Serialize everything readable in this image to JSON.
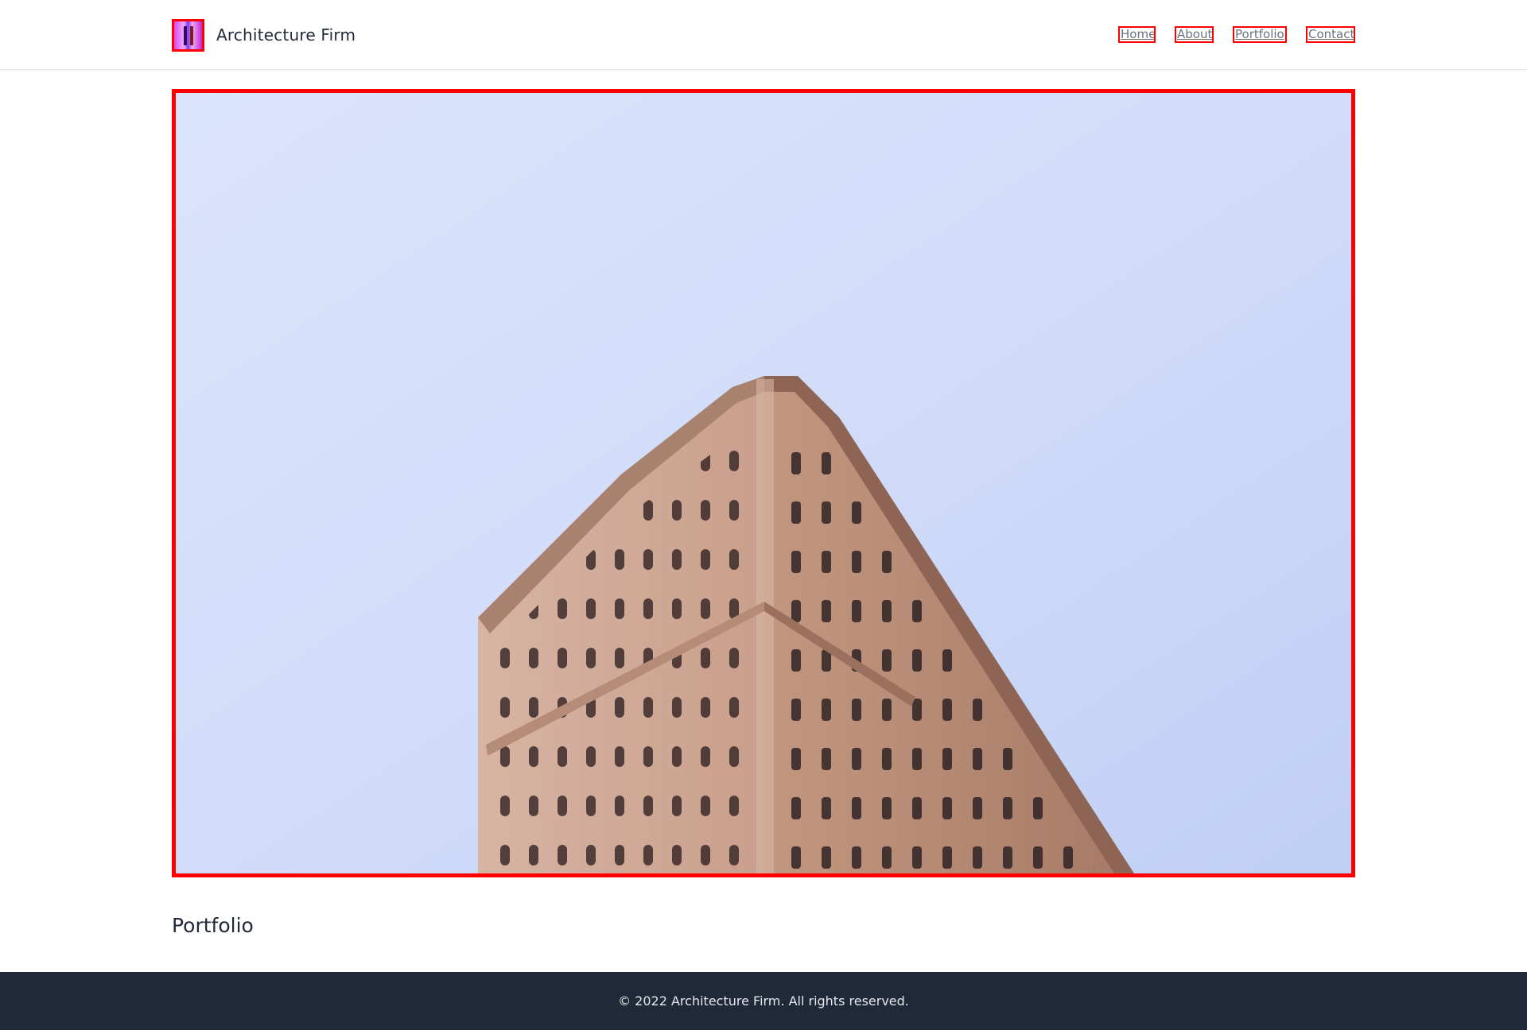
{
  "brand": {
    "name": "Architecture Firm",
    "logo_icon": "building-logo-icon"
  },
  "nav": {
    "items": [
      {
        "label": "Home"
      },
      {
        "label": "About"
      },
      {
        "label": "Portfolio"
      },
      {
        "label": "Contact"
      }
    ]
  },
  "hero": {
    "image": "flatiron-building-photo"
  },
  "section": {
    "title": "Portfolio"
  },
  "footer": {
    "text": "© 2022 Architecture Firm. All rights reserved."
  },
  "colors": {
    "highlight_border": "#ff0000",
    "footer_bg": "#1f2937",
    "sky": "#d3defa",
    "building": "#c99b86"
  }
}
